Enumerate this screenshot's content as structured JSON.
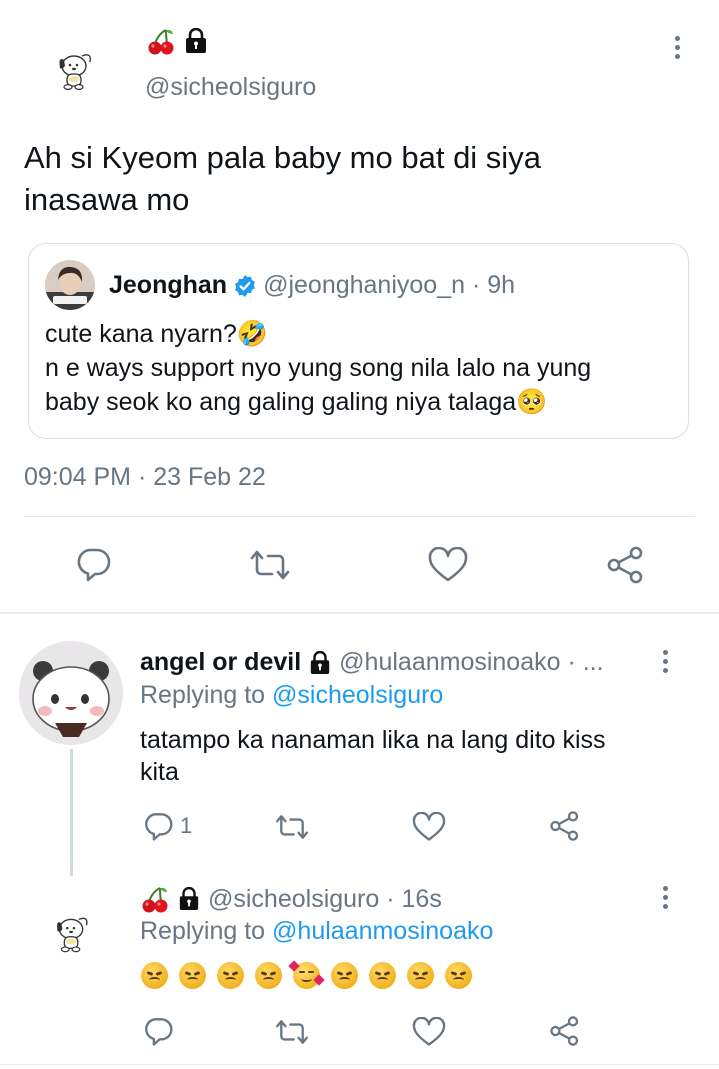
{
  "main_tweet": {
    "display_name_emoji": "🍒",
    "lock_icon": "lock-icon",
    "handle": "@sicheolsiguro",
    "text_line1": "Ah si Kyeom pala baby mo bat di siya",
    "text_line2": "inasawa mo",
    "timestamp": "09:04 PM · 23 Feb 22"
  },
  "quoted_tweet": {
    "name": "Jeonghan",
    "handle_time": "@jeonghaniyoo_n · 9h",
    "line1": "cute kana nyarn?🤣",
    "line2": "n e ways support nyo yung song nila lalo na yung",
    "line3": "baby seok ko ang galing galing niya talaga🥺"
  },
  "reply1": {
    "name": "angel or devil",
    "handle": "@hulaanmosinoako · ...",
    "replying_prefix": "Replying to ",
    "replying_to": "@sicheolsiguro",
    "text_line1": "tatampo ka nanaman lika na lang dito kiss",
    "text_line2": "kita",
    "reply_count": "1"
  },
  "reply2": {
    "name_emoji": "🍒",
    "handle": "@sicheolsiguro · 16s",
    "replying_prefix": "Replying to ",
    "replying_to": "@hulaanmosinoako"
  },
  "colors": {
    "accent": "#1d9bf0",
    "muted": "#687684",
    "divider": "#e1e8ed",
    "verified": "#1d9bf0"
  },
  "icons": [
    "reply-icon",
    "retweet-icon",
    "like-icon",
    "share-icon",
    "more-icon",
    "verified-badge-icon",
    "cherry-icon",
    "lock-icon"
  ]
}
